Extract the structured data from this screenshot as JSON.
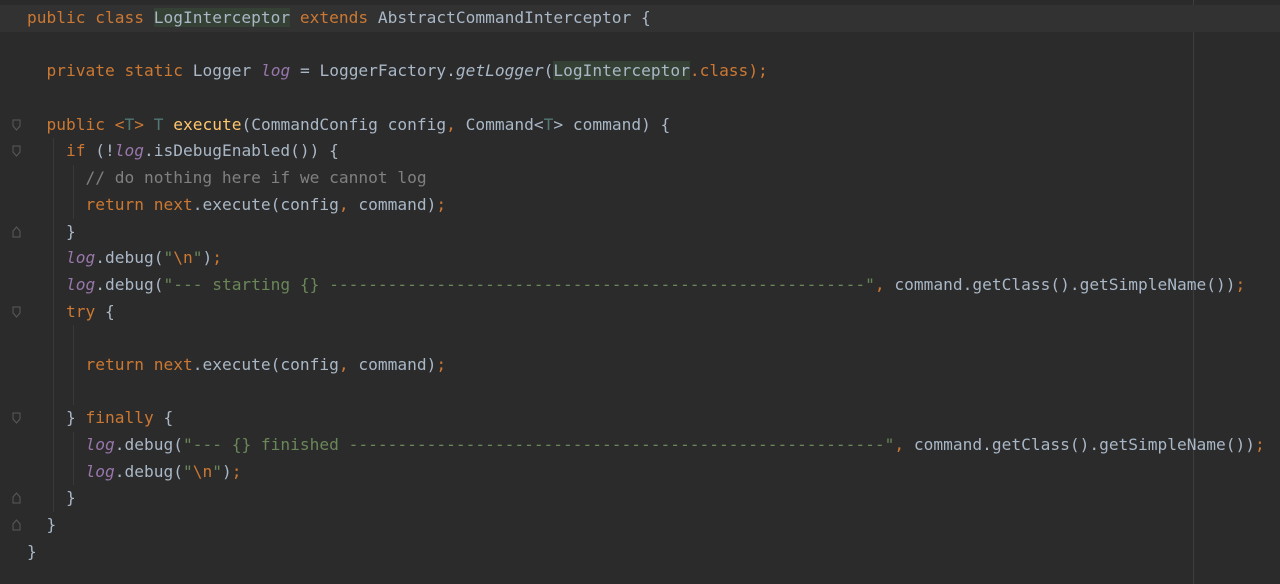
{
  "editor": {
    "language": "java",
    "colors": {
      "background": "#2b2b2b",
      "text": "#a9b7c6",
      "keyword": "#cc7832",
      "method_decl": "#ffc66d",
      "string": "#6a8759",
      "comment": "#808080",
      "static_field": "#9876aa",
      "type_param": "#507874"
    },
    "lines": [
      {
        "class_line": {
          "kw_public": "public",
          "kw_class": "class",
          "class_name": "LogInterceptor",
          "kw_extends": "extends",
          "super_name": "AbstractCommandInterceptor",
          "brace": "{"
        }
      },
      {
        "field_line": {
          "kw_private": "private",
          "kw_static": "static",
          "type": "Logger",
          "name": "log",
          "eq": "=",
          "factory": "LoggerFactory.",
          "method": "getLogger",
          "open": "(",
          "arg": "LogInterceptor",
          "arg_suffix": ".class",
          "close": ");"
        }
      },
      {
        "method_line": {
          "kw_public": "public",
          "tparam": "<T>",
          "ret": "T",
          "name": "execute",
          "params_a": "(CommandConfig config",
          "comma": ",",
          "params_b": " Command<",
          "tp": "T",
          "params_c": "> command) {"
        }
      },
      {
        "if_line": {
          "kw_if": "if",
          "text_a": " (!",
          "field": "log",
          "text_b": ".isDebugEnabled()) {"
        }
      },
      {
        "comment_line": {
          "text": "// do nothing here if we cannot log"
        }
      },
      {
        "return_line_1": {
          "kw_return": "return",
          "kw_next": "next",
          "text_a": ".execute(config",
          "comma": ",",
          "text_b": " command)",
          "semi": ";"
        }
      },
      {
        "close_if": {
          "text": "}"
        }
      },
      {
        "debug_1": {
          "field": "log",
          "text_a": ".debug(",
          "str_a": "\"",
          "esc": "\\n",
          "str_b": "\"",
          "text_b": ")",
          "semi": ";"
        }
      },
      {
        "debug_2": {
          "field": "log",
          "text_a": ".debug(",
          "str": "\"--- starting {} -------------------------------------------------------\"",
          "comma": ",",
          "text_b": " command.getClass().getSimpleName())",
          "semi": ";"
        }
      },
      {
        "try_line": {
          "kw_try": "try",
          "text": " {"
        }
      },
      {
        "blank_1": {}
      },
      {
        "return_line_2": {
          "kw_return": "return",
          "kw_next": "next",
          "text_a": ".execute(config",
          "comma": ",",
          "text_b": " command)",
          "semi": ";"
        }
      },
      {
        "blank_2": {}
      },
      {
        "finally_line": {
          "text_a": "} ",
          "kw_finally": "finally",
          "text_b": " {"
        }
      },
      {
        "debug_3": {
          "field": "log",
          "text_a": ".debug(",
          "str": "\"--- {} finished -------------------------------------------------------\"",
          "comma": ",",
          "text_b": " command.getClass().getSimpleName())",
          "semi": ";"
        }
      },
      {
        "debug_4": {
          "field": "log",
          "text_a": ".debug(",
          "str_a": "\"",
          "esc": "\\n",
          "str_b": "\"",
          "text_b": ")",
          "semi": ";"
        }
      },
      {
        "close_try": {
          "text": "}"
        }
      },
      {
        "close_method": {
          "text": "}"
        }
      },
      {
        "close_class": {
          "text": "}"
        }
      }
    ]
  }
}
